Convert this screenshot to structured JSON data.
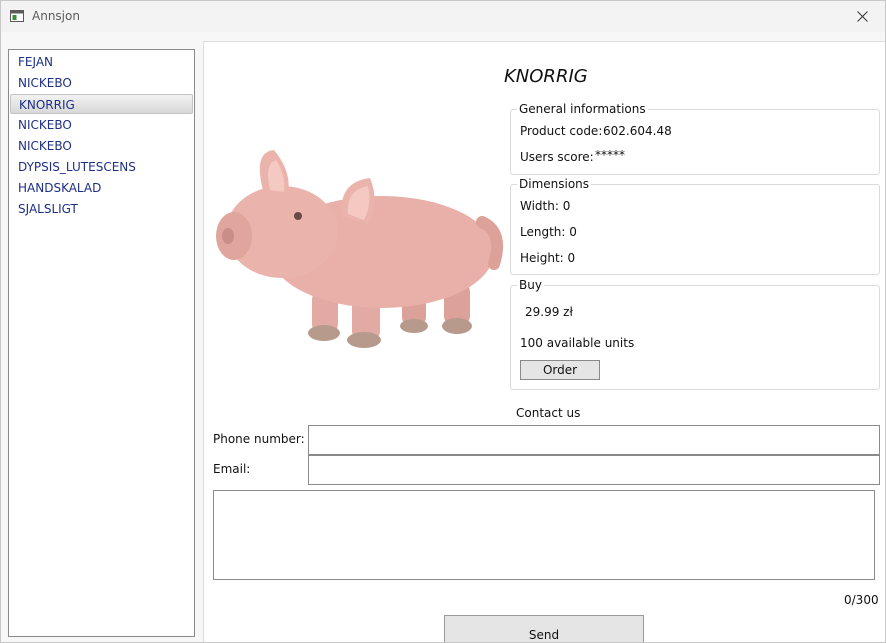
{
  "window": {
    "title": "Annsjon"
  },
  "product_list": {
    "items": [
      {
        "label": "FEJAN"
      },
      {
        "label": "NICKEBO"
      },
      {
        "label": "KNORRIG"
      },
      {
        "label": "NICKEBO"
      },
      {
        "label": "NICKEBO"
      },
      {
        "label": "DYPSIS_LUTESCENS"
      },
      {
        "label": "HANDSKALAD"
      },
      {
        "label": "SJALSLIGT"
      }
    ],
    "selected_index": 2
  },
  "product": {
    "name": "KNORRIG",
    "image_icon": "pink-plush-pig"
  },
  "general": {
    "title": "General informations",
    "code_label": "Product code:",
    "code_value": "602.604.48",
    "score_label": "Users score:",
    "score_value": "*****"
  },
  "dimensions": {
    "title": "Dimensions",
    "width": "Width: 0",
    "length": "Length: 0",
    "height": "Height: 0"
  },
  "buy": {
    "title": "Buy",
    "price": "29.99 zł",
    "available": "100 available units",
    "order_label": "Order"
  },
  "contact": {
    "title": "Contact us",
    "phone_label": "Phone number:",
    "phone_value": "",
    "email_label": "Email:",
    "email_value": "",
    "message_value": "",
    "counter": "0/300",
    "send_label": "Send"
  },
  "colors": {
    "list_text": "#1e2f87",
    "selected_bg": "#dcdcdc",
    "button_bg": "#e5e5e5"
  }
}
